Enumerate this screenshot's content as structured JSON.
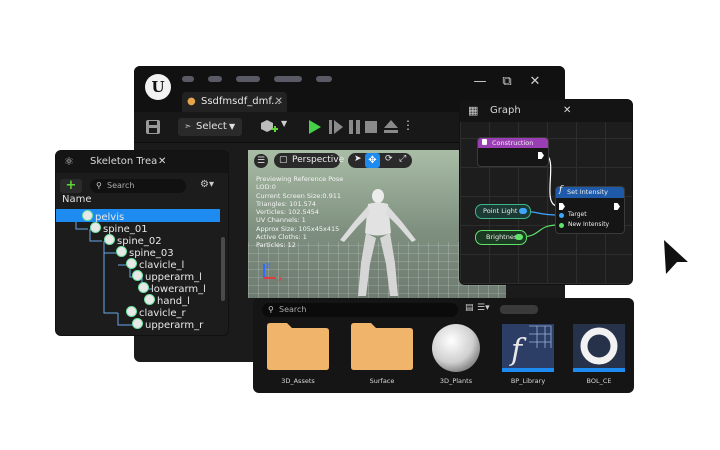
{
  "editor": {
    "logo": "U",
    "tab_title": "Ssdfmsdf_dmf...",
    "toolbar": {
      "select_label": "Select",
      "more": "⋮"
    },
    "window_controls": {
      "minimize": "—",
      "restore": "⧉",
      "close": "✕"
    }
  },
  "skeleton_tree": {
    "title": "Skeleton Trea",
    "close": "✕",
    "add": "+",
    "search_placeholder": "Search",
    "column_header": "Name",
    "bones": [
      "pelvis",
      "spine_01",
      "spine_02",
      "spine_03",
      "clavicle_l",
      "upperarm_l",
      "lowerarm_l",
      "hand_l",
      "clavicle_r",
      "upperarm_r"
    ],
    "selected_bone": "pelvis"
  },
  "viewport": {
    "mode_label": "Perspective",
    "stats": [
      "Previewing Reference Pose",
      "LOD:0",
      "Current Screen Size:0.911",
      "Triangles: 101.574",
      "Verticles: 102.5454",
      "UV Channels: 1",
      "Approx Size: 105x45x415",
      "Active Cloths: 1",
      "Particles: 12"
    ],
    "axis_labels": {
      "z": "z",
      "x": "x"
    }
  },
  "graph": {
    "title": "Graph",
    "close": "✕",
    "nodes": {
      "construction": "Construction",
      "set_intensity": "Set Intensity",
      "set_intensity_pins": [
        "Target",
        "New Intensity"
      ]
    },
    "variables": [
      "Point Light 1",
      "Brightness"
    ],
    "func_icon": "f"
  },
  "content_browser": {
    "search_placeholder": "Search",
    "assets": [
      {
        "label": "3D_Assets",
        "icon": "folder-icon"
      },
      {
        "label": "Surface",
        "icon": "folder-icon"
      },
      {
        "label": "3D_Plants",
        "icon": "sphere-icon"
      },
      {
        "label": "BP_Library",
        "icon": "blueprint-function-icon"
      },
      {
        "label": "BOL_CE",
        "icon": "ring-icon"
      }
    ]
  },
  "colors": {
    "accent_blue": "#1d8bf0",
    "construction_header": "#9a3fb3",
    "set_intensity_header": "#1f5aa8",
    "play_green": "#45d14a",
    "folder": "#f0b46a"
  }
}
